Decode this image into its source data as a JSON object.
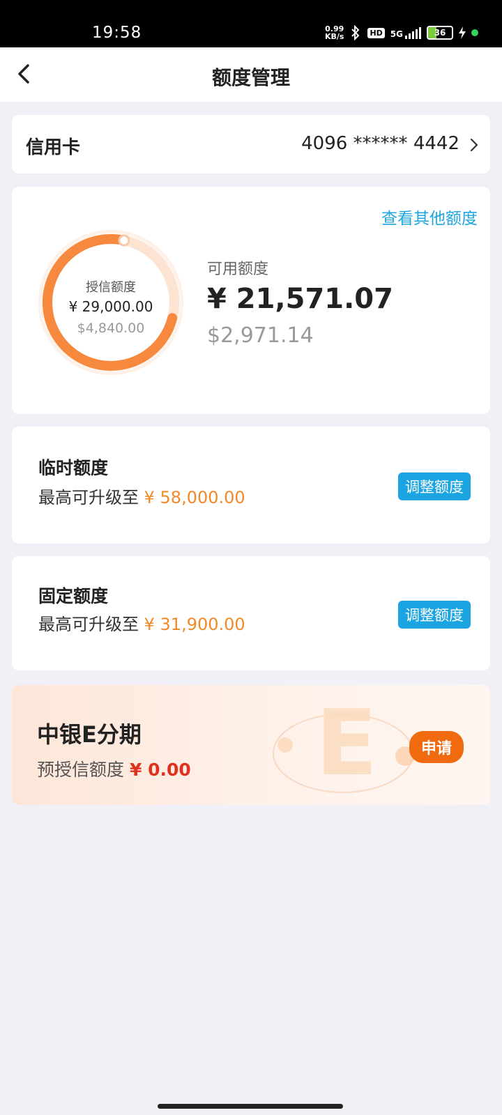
{
  "status_bar": {
    "time": "19:58",
    "net_speed_value": "0.99",
    "net_speed_unit": "KB/s",
    "hd_badge": "HD",
    "network": "5G",
    "battery": "36",
    "icons": [
      "bluetooth-icon",
      "signal-icon",
      "battery-icon",
      "charging-icon"
    ]
  },
  "nav": {
    "title": "额度管理",
    "back_icon": "chevron-left-icon"
  },
  "credit_card": {
    "label": "信用卡",
    "number": "4096 ****** 4442"
  },
  "quota": {
    "other_link": "查看其他额度",
    "credit_label": "授信额度",
    "credit_amount": "¥ 29,000.00",
    "credit_usd": "$4,840.00",
    "available_label": "可用额度",
    "available_amount": "¥ 21,571.07",
    "available_usd": "$2,971.14",
    "used_fraction": 0.744
  },
  "temp_quota": {
    "title": "临时额度",
    "prefix": "最高可升级至",
    "amount": "¥ 58,000.00",
    "button": "调整额度"
  },
  "fixed_quota": {
    "title": "固定额度",
    "prefix": "最高可升级至",
    "amount": "¥ 31,900.00",
    "button": "调整额度"
  },
  "installment": {
    "title": "中银E分期",
    "prefix": "预授信额度",
    "amount": "¥ 0.00",
    "button": "申请"
  },
  "colors": {
    "accent_blue": "#1ba4e2",
    "accent_orange": "#f08a28",
    "apply_orange": "#f06a10",
    "amount_red": "#e0301e"
  }
}
